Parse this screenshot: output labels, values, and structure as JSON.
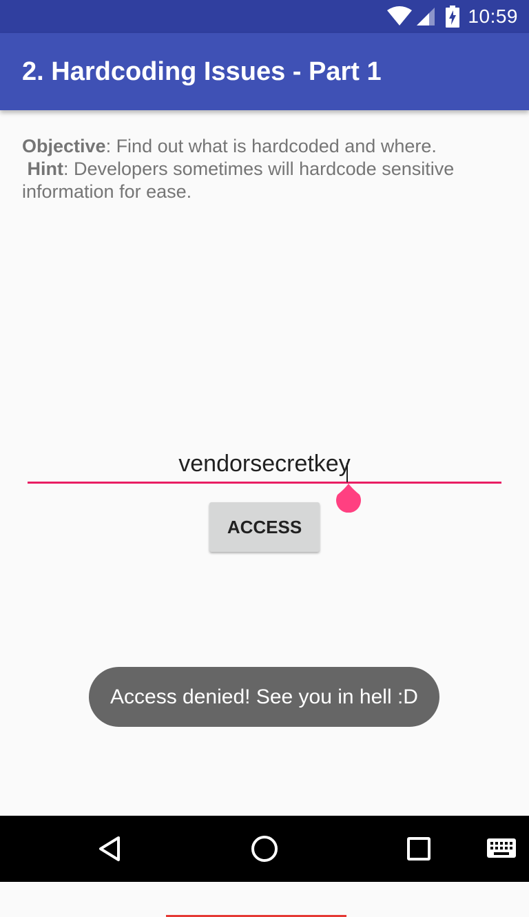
{
  "status_bar": {
    "time": "10:59",
    "icons": [
      "wifi-icon",
      "cell-signal-icon",
      "battery-charging-icon"
    ]
  },
  "app_bar": {
    "title": "2. Hardcoding Issues - Part 1"
  },
  "info": {
    "objective_label": "Objective",
    "objective_text": ": Find out what is hardcoded and where.",
    "hint_label": "Hint",
    "hint_text": ": Developers sometimes will hardcode sensitive information for ease."
  },
  "input": {
    "value": "vendorsecretkey"
  },
  "button": {
    "access_label": "ACCESS"
  },
  "toast": {
    "message": "Access denied! See you in hell :D"
  },
  "nav_bar": {
    "icons": [
      "back-icon",
      "home-icon",
      "recents-icon",
      "keyboard-icon"
    ]
  },
  "colors": {
    "status_bar": "#303f9f",
    "app_bar": "#3f51b5",
    "accent": "#e91e63",
    "handle": "#ff4081",
    "toast": "#666666"
  }
}
